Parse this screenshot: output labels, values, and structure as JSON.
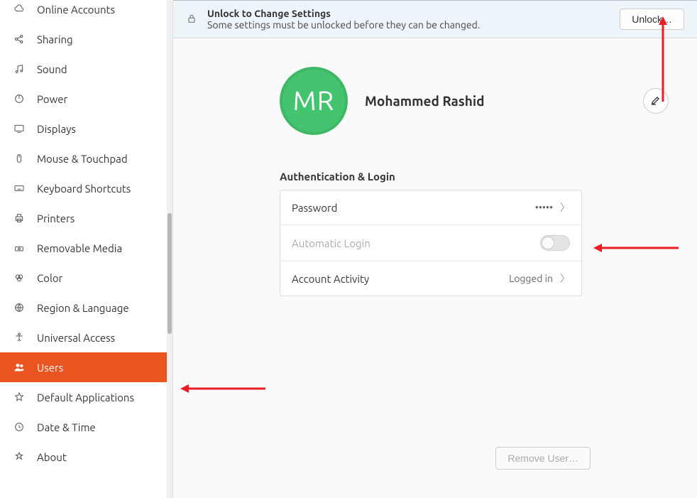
{
  "sidebar": {
    "items": [
      {
        "label": "Online Accounts"
      },
      {
        "label": "Sharing"
      },
      {
        "label": "Sound"
      },
      {
        "label": "Power"
      },
      {
        "label": "Displays"
      },
      {
        "label": "Mouse & Touchpad"
      },
      {
        "label": "Keyboard Shortcuts"
      },
      {
        "label": "Printers"
      },
      {
        "label": "Removable Media"
      },
      {
        "label": "Color"
      },
      {
        "label": "Region & Language"
      },
      {
        "label": "Universal Access"
      },
      {
        "label": "Users"
      },
      {
        "label": "Default Applications"
      },
      {
        "label": "Date & Time"
      },
      {
        "label": "About"
      }
    ]
  },
  "lockbar": {
    "title": "Unlock to Change Settings",
    "subtitle": "Some settings must be unlocked before they can be changed.",
    "button": "Unlock…"
  },
  "user": {
    "initials": "MR",
    "name": "Mohammed Rashid"
  },
  "section": {
    "title": "Authentication & Login",
    "password_label": "Password",
    "password_value": "•••••",
    "autologin_label": "Automatic Login",
    "autologin_on": false,
    "activity_label": "Account Activity",
    "activity_value": "Logged in"
  },
  "footer": {
    "remove_user": "Remove User…"
  }
}
